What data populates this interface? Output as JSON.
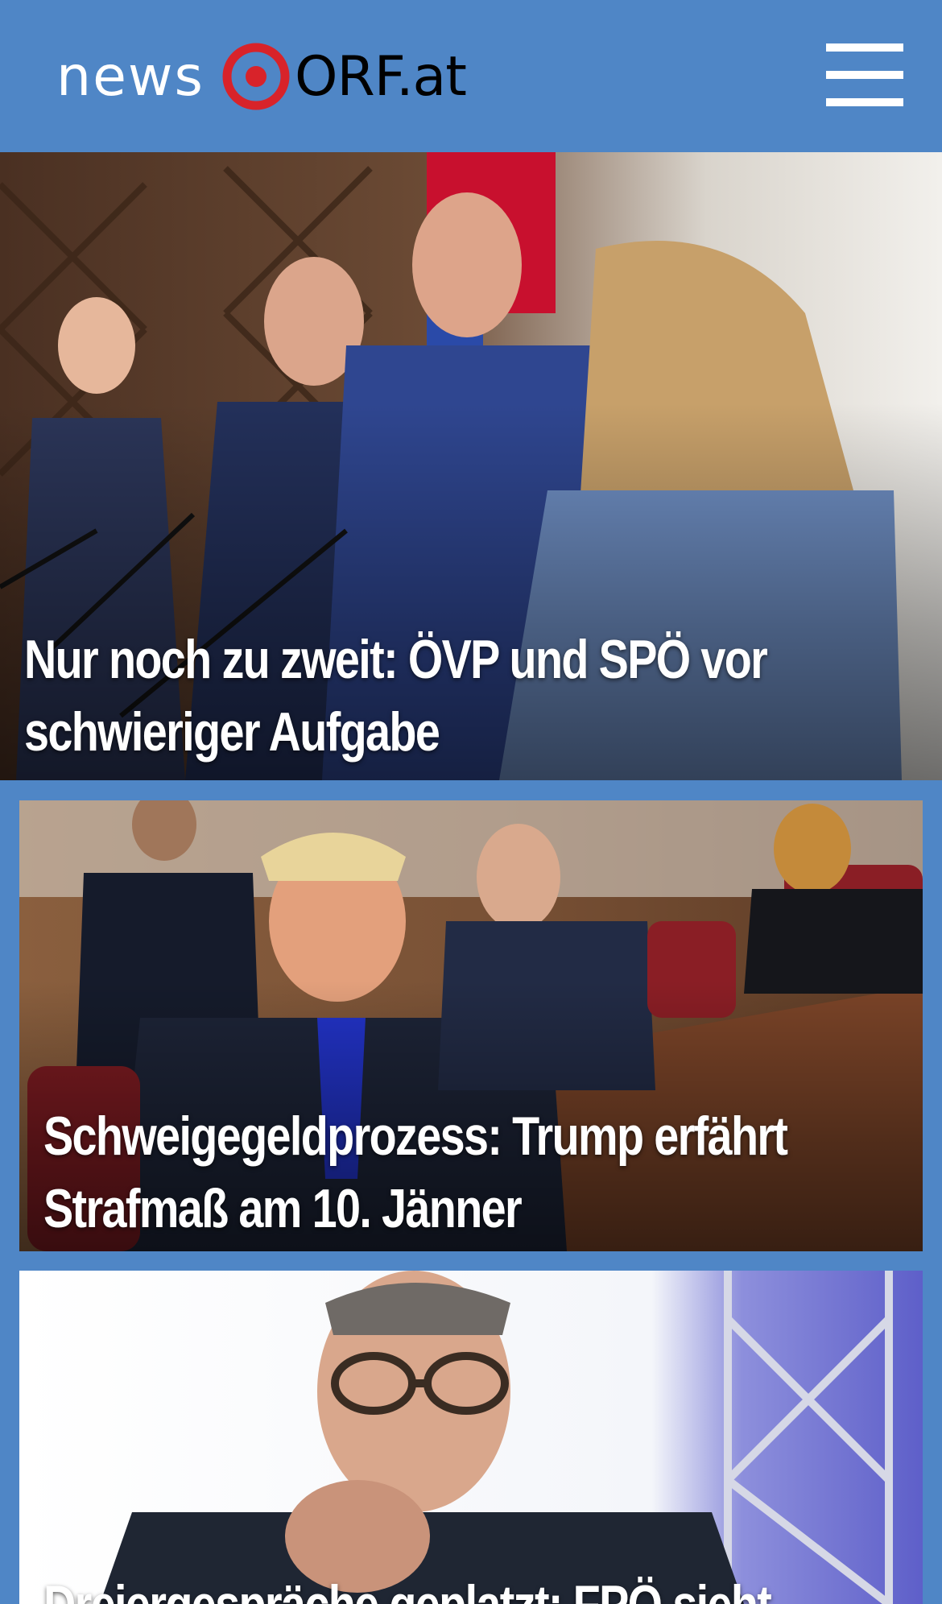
{
  "header": {
    "logo_news": "news",
    "logo_orf": "ORF.at",
    "menu_icon": "hamburger-menu-icon"
  },
  "colors": {
    "header_bg": "#4f86c6",
    "logo_red": "#d8232a",
    "headline_text": "#ffffff"
  },
  "articles": [
    {
      "headline": "Nur noch zu zweit: ÖVP und SPÖ vor schwieriger Aufgabe"
    },
    {
      "headline": "Schweigegeldprozess: Trump erfährt Strafmaß am 10. Jänner"
    },
    {
      "headline": "Dreiergespräche geplatzt: FPÖ sieht"
    }
  ]
}
